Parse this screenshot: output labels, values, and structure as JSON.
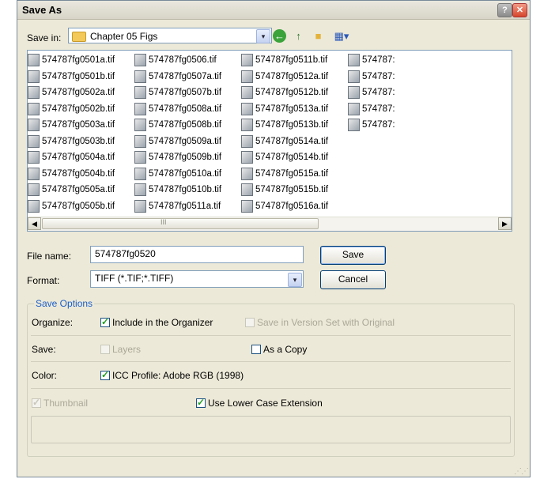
{
  "dialog": {
    "title": "Save As",
    "help_label": "?",
    "close_label": "✕"
  },
  "toolbar": {
    "save_in_label": "Save in:",
    "save_in_value": "Chapter 05 Figs",
    "dropdown_glyph": "▾",
    "views_glyph": "▦▾"
  },
  "files": [
    "574787fg0501a.tif",
    "574787fg0501b.tif",
    "574787fg0502a.tif",
    "574787fg0502b.tif",
    "574787fg0503a.tif",
    "574787fg0503b.tif",
    "574787fg0504a.tif",
    "574787fg0504b.tif",
    "574787fg0505a.tif",
    "574787fg0505b.tif",
    "574787fg0506.tif",
    "574787fg0507a.tif",
    "574787fg0507b.tif",
    "574787fg0508a.tif",
    "574787fg0508b.tif",
    "574787fg0509a.tif",
    "574787fg0509b.tif",
    "574787fg0510a.tif",
    "574787fg0510b.tif",
    "574787fg0511a.tif",
    "574787fg0511b.tif",
    "574787fg0512a.tif",
    "574787fg0512b.tif",
    "574787fg0513a.tif",
    "574787fg0513b.tif",
    "574787fg0514a.tif",
    "574787fg0514b.tif",
    "574787fg0515a.tif",
    "574787fg0515b.tif",
    "574787fg0516a.tif",
    "574787:",
    "574787:",
    "574787:",
    "574787:",
    "574787:"
  ],
  "scrollbar": {
    "left_glyph": "◀",
    "right_glyph": "▶",
    "grip_glyph": "III"
  },
  "form": {
    "file_name_label": "File name:",
    "file_name_value": "574787fg0520",
    "format_label": "Format:",
    "format_value": "TIFF (*.TIF;*.TIFF)",
    "save_button": "Save",
    "cancel_button": "Cancel"
  },
  "options": {
    "title": "Save Options",
    "organize_label": "Organize:",
    "include_organizer": "Include in the Organizer",
    "version_set": "Save in Version Set with Original",
    "save_label": "Save:",
    "layers": "Layers",
    "as_copy": "As a Copy",
    "color_label": "Color:",
    "icc_profile": "ICC Profile:  Adobe RGB (1998)",
    "thumbnail": "Thumbnail",
    "lower_case": "Use Lower Case Extension"
  },
  "colors": {
    "accent": "#1c5ec9",
    "dialog_bg": "#ece9d8",
    "border_blue": "#7f9db9"
  }
}
